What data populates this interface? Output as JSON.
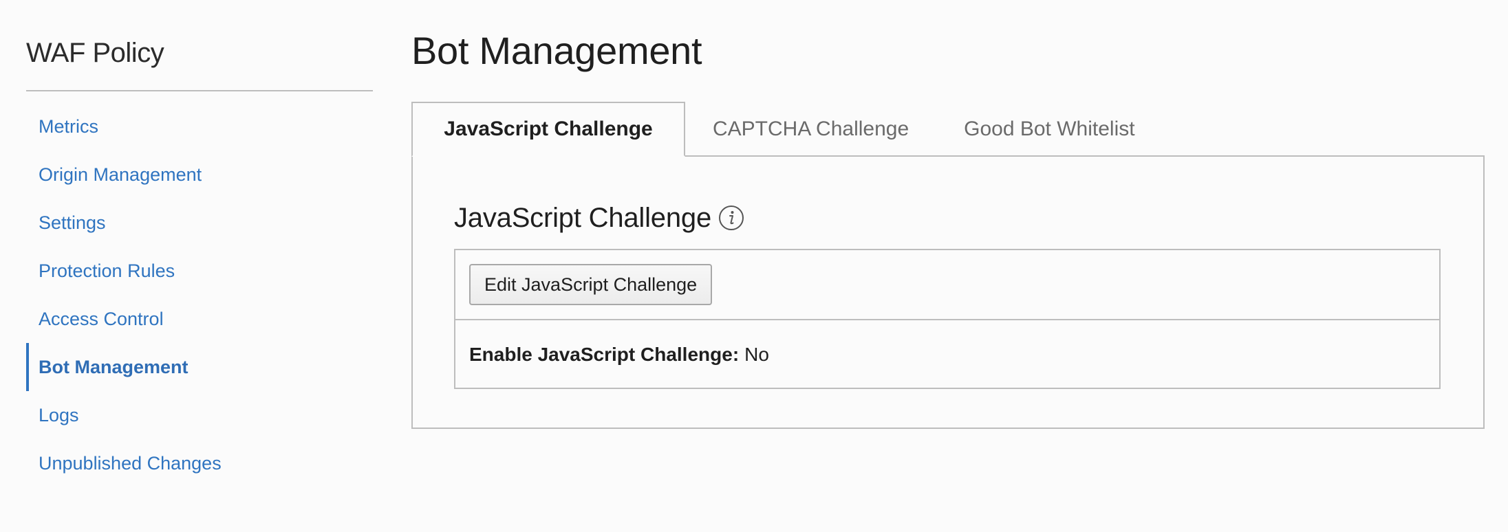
{
  "sidebar": {
    "title": "WAF Policy",
    "items": [
      {
        "label": "Metrics"
      },
      {
        "label": "Origin Management"
      },
      {
        "label": "Settings"
      },
      {
        "label": "Protection Rules"
      },
      {
        "label": "Access Control"
      },
      {
        "label": "Bot Management",
        "active": true
      },
      {
        "label": "Logs"
      },
      {
        "label": "Unpublished Changes"
      }
    ]
  },
  "main": {
    "title": "Bot Management",
    "tabs": [
      {
        "label": "JavaScript Challenge",
        "active": true
      },
      {
        "label": "CAPTCHA Challenge"
      },
      {
        "label": "Good Bot Whitelist"
      }
    ],
    "section": {
      "title": "JavaScript Challenge",
      "info_icon": "info-icon",
      "edit_button_label": "Edit JavaScript Challenge",
      "field_label": "Enable JavaScript Challenge:",
      "field_value": "No"
    }
  },
  "colors": {
    "link": "#2f74c0",
    "border": "#bdbdbd",
    "background": "#fbfbfb",
    "text": "#1f1f1f"
  }
}
